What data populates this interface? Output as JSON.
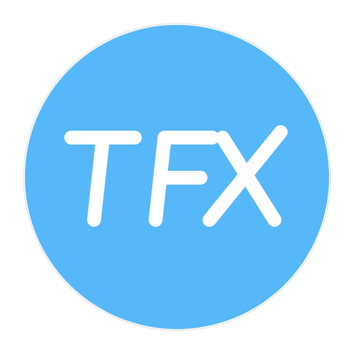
{
  "logo": {
    "text": "TFX",
    "background_color": "#56b7f9",
    "text_color": "#ffffff",
    "border_color": "#e6e6e6"
  }
}
